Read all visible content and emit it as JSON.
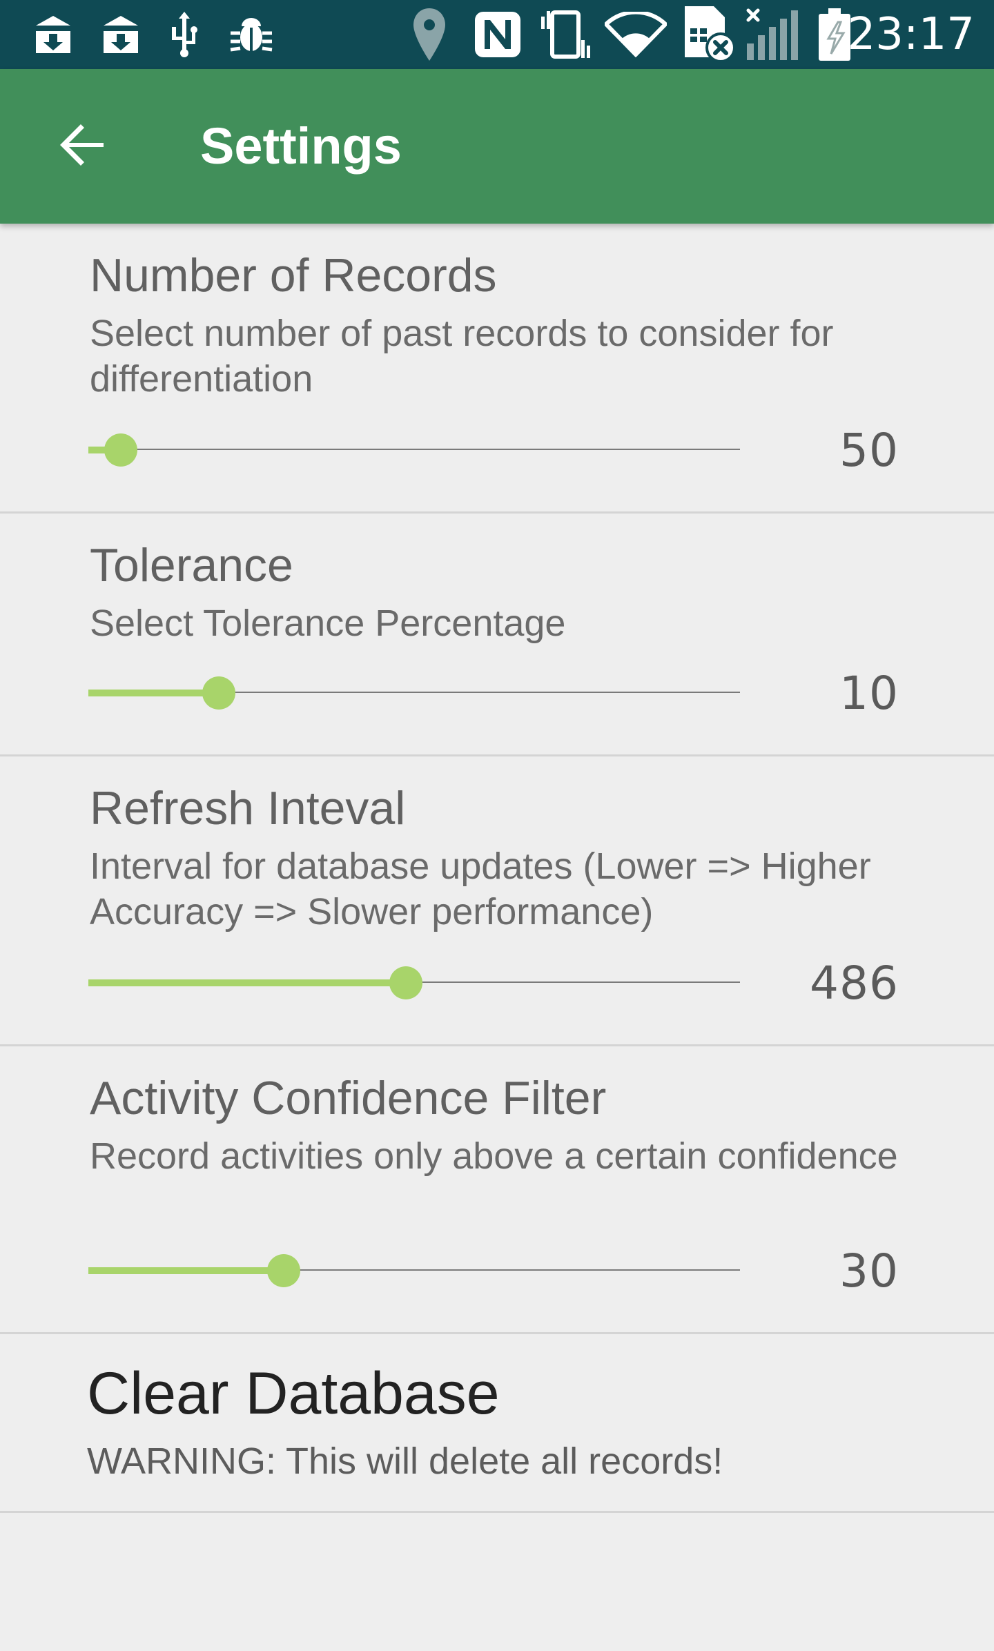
{
  "status_bar": {
    "time": "23:17",
    "left_icons": [
      "download-notification-icon",
      "download-notification-icon",
      "usb-icon",
      "debug-bug-icon"
    ],
    "right_icons": [
      "location-pin-icon",
      "nfc-icon",
      "vibrate-icon",
      "wifi-icon",
      "sim-card-error-icon",
      "cell-signal-no-service-icon",
      "battery-charging-icon"
    ]
  },
  "app_bar": {
    "title": "Settings",
    "back_icon": "back-arrow-icon",
    "color": "#418f5a"
  },
  "accent_color": "#a8d46a",
  "preferences": [
    {
      "title": "Number of Records",
      "summary": "Select number of past records to consider for differentiation",
      "value": "50",
      "level": 0.05
    },
    {
      "title": "Tolerance",
      "summary": "Select Tolerance Percentage",
      "value": "10",
      "level": 0.2
    },
    {
      "title": "Refresh Inteval",
      "summary": "Interval for database updates (Lower => Higher Accuracy => Slower performance)",
      "value": "486",
      "level": 0.487
    },
    {
      "title": "Activity Confidence Filter",
      "summary": "Record activities only above a certain confidence",
      "value": "30",
      "level": 0.3
    }
  ],
  "clear_database": {
    "title": "Clear Database",
    "summary": "WARNING: This will delete all records!"
  }
}
